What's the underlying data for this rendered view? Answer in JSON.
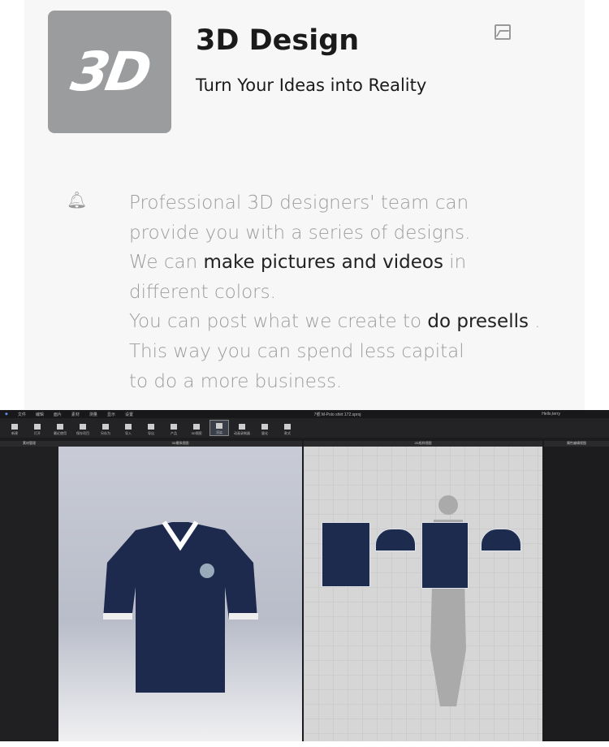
{
  "header": {
    "title": "3D Design",
    "subtitle": "Turn Your Ideas into Reality",
    "logo_text": "3D"
  },
  "icons": [
    "image-icon",
    "bell-icon"
  ],
  "description": [
    {
      "parts": [
        {
          "text": "Professional 3D designers' team can",
          "hl": false
        }
      ]
    },
    {
      "parts": [
        {
          "text": "provide you with a series of designs.",
          "hl": false
        }
      ]
    },
    {
      "parts": [
        {
          "text": "We can ",
          "hl": false
        },
        {
          "text": "make pictures and videos",
          "hl": true
        },
        {
          "text": " in",
          "hl": false
        }
      ]
    },
    {
      "parts": [
        {
          "text": "different colors.",
          "hl": false
        }
      ]
    },
    {
      "parts": [
        {
          "text": "You can post what we create to ",
          "hl": false
        },
        {
          "text": "do presells",
          "hl": true
        },
        {
          "text": " .",
          "hl": false
        }
      ]
    },
    {
      "parts": [
        {
          "text": "This way you can spend less capital",
          "hl": false
        }
      ]
    },
    {
      "parts": [
        {
          "text": "to do a more business.",
          "hl": false
        }
      ]
    }
  ],
  "app": {
    "menu": [
      "文件",
      "编辑",
      "面片",
      "素材",
      "测量",
      "显示",
      "设置"
    ],
    "window_title": "7號 M-Polo shirt 172.sproj",
    "user": "Hello,terry",
    "toolbar": [
      "新建",
      "打开",
      "最近使用",
      "保存项目",
      "另存为",
      "导入",
      "导出",
      "产品",
      "3D视图",
      "渲染",
      "动画录制器",
      "量化",
      "款式"
    ],
    "panels": {
      "left": "素材管理",
      "view3d": "3D模拟视图",
      "view2d": "2D纸样视图",
      "right": "属性编辑视图"
    }
  }
}
